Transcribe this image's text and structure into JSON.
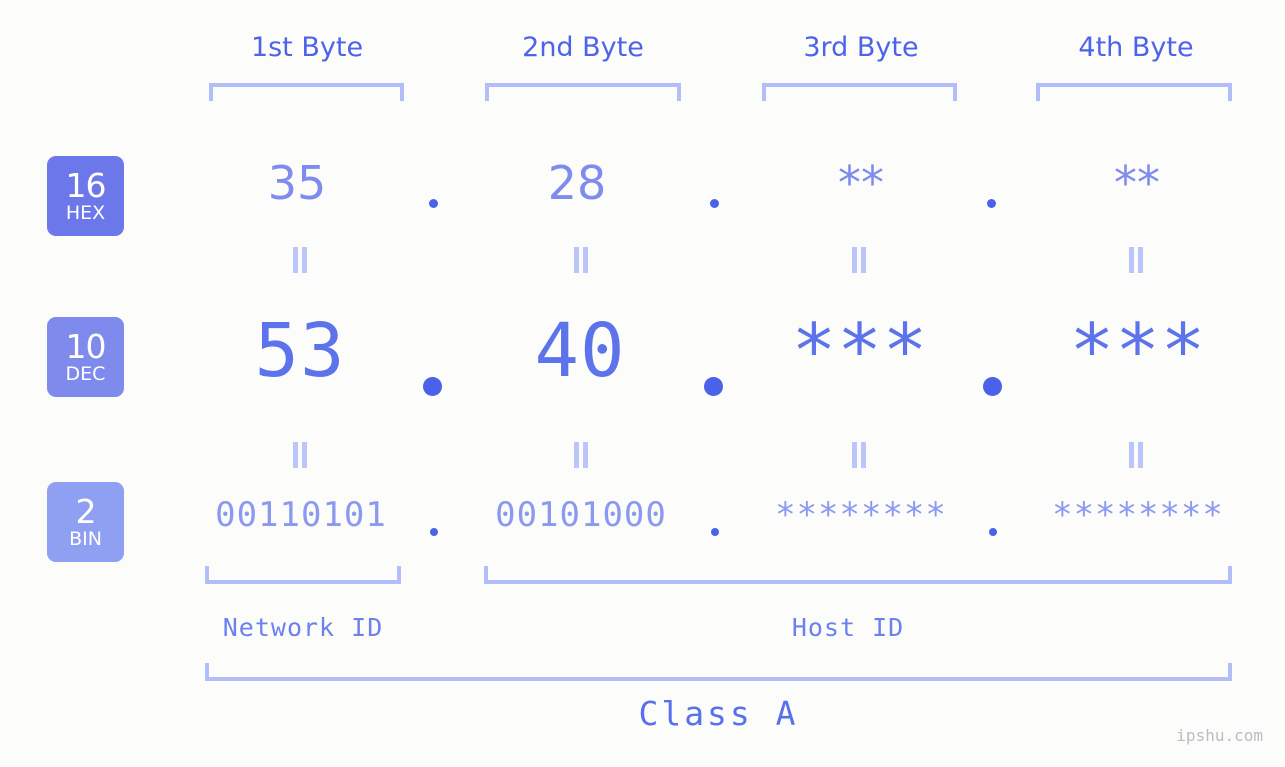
{
  "background_color": "#fcfdfa",
  "accent_colors": {
    "header_text": "#4d63e8",
    "bracket": "#b3bdf7",
    "hex_value": "#808ced",
    "dec_value": "#5c73ec",
    "bin_value": "#8b99f0",
    "dot": "#4a62e8",
    "equals_bar": "#bcc5f8",
    "badge_hex": "#6c77e9",
    "badge_dec": "#7e8aec",
    "badge_bin": "#8fa0f2",
    "watermark": "#b9bdc4"
  },
  "byte_headers": [
    {
      "label": "1st Byte"
    },
    {
      "label": "2nd Byte"
    },
    {
      "label": "3rd Byte"
    },
    {
      "label": "4th Byte"
    }
  ],
  "radix_badges": [
    {
      "number": "16",
      "name": "HEX"
    },
    {
      "number": "10",
      "name": "DEC"
    },
    {
      "number": "2",
      "name": "BIN"
    }
  ],
  "rows": {
    "hex": {
      "values": [
        "35",
        "28",
        "**",
        "**"
      ],
      "separator": "."
    },
    "dec": {
      "values": [
        "53",
        "40",
        "***",
        "***"
      ],
      "separator": "."
    },
    "bin": {
      "values": [
        "00110101",
        "00101000",
        "********",
        "********"
      ],
      "separator": "."
    }
  },
  "equals_marker": "=",
  "sections": [
    {
      "label": "Network ID"
    },
    {
      "label": "Host ID"
    }
  ],
  "class_label": "Class A",
  "watermark": "ipshu.com"
}
